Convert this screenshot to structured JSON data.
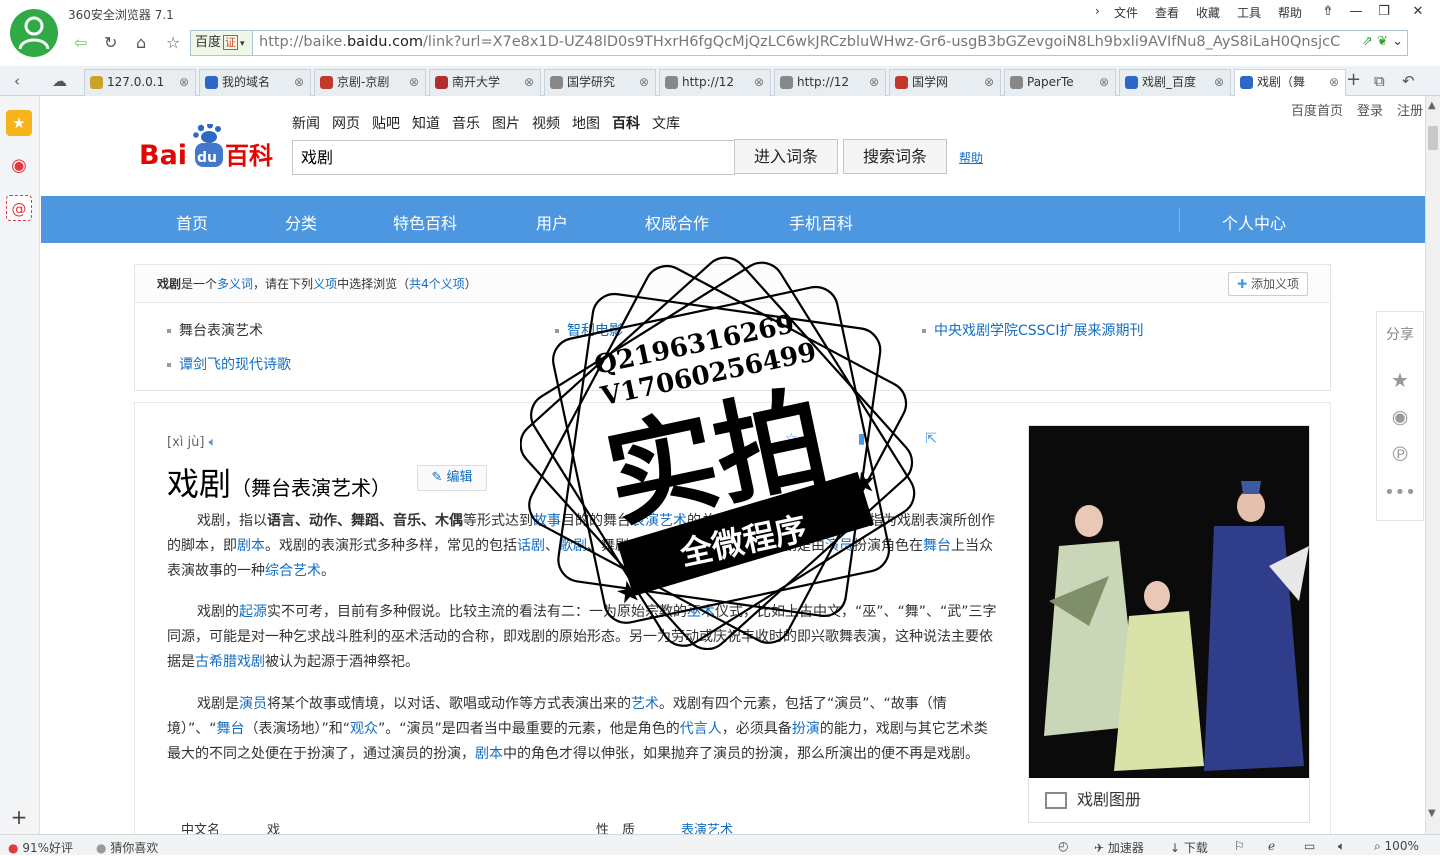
{
  "browser": {
    "title": "360安全浏览器 7.1",
    "menu": [
      "文件",
      "查看",
      "收藏",
      "工具",
      "帮助"
    ],
    "engine": "百度",
    "cert": "证",
    "url_host": "http://baike.",
    "url_domain": "baidu.com",
    "url_rest": "/link?url=X7e8x1D-UZ48lD0s9THxrH6fgQcMjQzLC6wkJRCzbluWHwz-Gr6-usgB3bGZevgoiN8Lh9bxli9AVIfNu8_AyS8iLaH0QnsjcC",
    "tabs": [
      "127.0.0.1",
      "我的域名",
      "京剧-京剧",
      "南开大学",
      "国学研究",
      "http://12",
      "http://12",
      "国学网",
      "PaperTe",
      "戏剧_百度",
      "戏剧（舞"
    ]
  },
  "sidebar": {
    "icons": [
      "favorites-star-icon",
      "weibo-icon",
      "mail-icon",
      "add-icon"
    ]
  },
  "baike": {
    "toplinks": [
      "百度首页",
      "登录",
      "注册"
    ],
    "logo_text": "Bai",
    "logo_du": "du",
    "logo_bk": "百科",
    "channels": [
      "新闻",
      "网页",
      "贴吧",
      "知道",
      "音乐",
      "图片",
      "视频",
      "地图",
      "百科",
      "文库"
    ],
    "search_value": "戏剧",
    "enter_btn": "进入词条",
    "search_btn": "搜索词条",
    "help": "帮助",
    "nav": [
      "首页",
      "分类",
      "特色百科",
      "用户",
      "权威合作",
      "手机百科",
      "个人中心"
    ],
    "poly": {
      "term": "戏剧",
      "t1": "是一个",
      "t2": "多义词",
      "t3": "，请在下列",
      "t4": "义项",
      "t5": "中选择浏览（",
      "t6": "共4个义项",
      "t7": "）",
      "add": "添加义项",
      "senses": [
        "舞台表演艺术",
        "智利电影",
        "中央戏剧学院CSSCI扩展来源期刊",
        "谭剑飞的现代诗歌"
      ]
    },
    "entry": {
      "pinyin": "[xì jù]",
      "title": "戏剧",
      "subtitle": "（舞台表演艺术）",
      "edit": "编辑",
      "p1": [
        "戏剧，指以",
        "语言、动作、舞蹈、音乐、木偶",
        "等形式达到",
        "故事",
        "目的的舞台",
        "表演艺术",
        "的总称。文学上的戏剧概念是指为戏剧表演所创作的脚本，即",
        "剧本",
        "。戏剧的表演形式多种多样，常见的包括",
        "话剧",
        "、",
        "歌剧",
        "、舞剧、音乐剧、木偶戏等。戏剧是由",
        "演员",
        "扮演角色在",
        "舞台",
        "上当众表演故事的一种",
        "综合艺术",
        "。"
      ],
      "p2": [
        "戏剧的",
        "起源",
        "实不可考，目前有多种假说。比较主流的看法有二：一为原始宗教的",
        "巫术",
        "仪式，比如上古中文，“巫”、“舞”、“武”三字同源，可能是对一种乞求战斗胜利的巫术活动的合称，即戏剧的原始形态。另一为劳动或庆祝丰收时的即兴歌舞表演，这种说法主要依据是",
        "古希腊戏剧",
        "被认为起源于酒神祭祀。"
      ],
      "p3": [
        "戏剧是",
        "演员",
        "将某个故事或情境，以对话、歌唱或动作等方式表演出来的",
        "艺术",
        "。戏剧有四个元素，包括了“演员”、“故事（情境）”、“",
        "舞台",
        "（表演场地）”和“",
        "观众",
        "”。“演员”是四者当中最重要的元素，他是角色的",
        "代言人",
        "，必须具备",
        "扮演",
        "的能力，戏剧与其它艺术类最大的不同之处便在于扮演了，通过演员的扮演，",
        "剧本",
        "中的角色才得以伸张，如果抛弃了演员的扮演，那么所演出的便不再是戏剧。"
      ],
      "gallery": "戏剧图册",
      "basic": {
        "k1": "中文名",
        "v1": "戏剧",
        "k2": "性　质",
        "v2": "表演艺术"
      }
    },
    "share": "分享"
  },
  "watermark": {
    "line1": "Q2196316269",
    "line2": "V17060256499",
    "big": "实拍",
    "ribbon": "全微程序"
  },
  "status": {
    "rating": "91%好评",
    "guess": "猜你喜欢",
    "accel": "加速器",
    "download": "下载",
    "zoom": "100%"
  }
}
